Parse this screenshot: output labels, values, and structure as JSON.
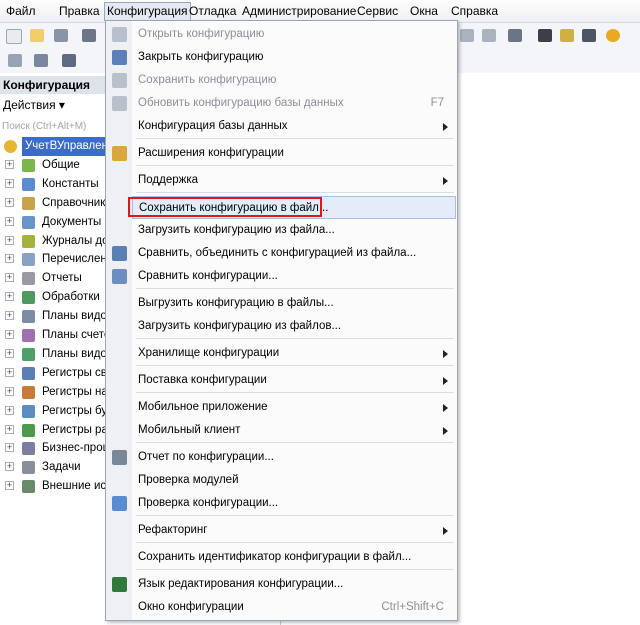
{
  "menubar": [
    "Файл",
    "Правка",
    "Конфигурация",
    "Отладка",
    "Администрирование",
    "Сервис",
    "Окна",
    "Справка"
  ],
  "left_panel": {
    "title": "Конфигурация",
    "actions": "Действия",
    "search_placeholder": "Поиск (Ctrl+Alt+M)",
    "root": "УчетВУправлен",
    "items": [
      "Общие",
      "Константы",
      "Справочники",
      "Документы",
      "Журналы док",
      "Перечисления",
      "Отчеты",
      "Обработки",
      "Планы видов",
      "Планы счетов",
      "Планы видов",
      "Регистры св",
      "Регистры на",
      "Регистры бу",
      "Регистры ра",
      "Бизнес-проц",
      "Задачи",
      "Внешние ис"
    ]
  },
  "menu": {
    "items": [
      {
        "label": "Открыть конфигурацию",
        "disabled": true
      },
      {
        "label": "Закрыть конфигурацию"
      },
      {
        "label": "Сохранить конфигурацию",
        "disabled": true
      },
      {
        "label": "Обновить конфигурацию базы данных",
        "disabled": true,
        "shortcut": "F7"
      },
      {
        "label": "Конфигурация базы данных",
        "submenu": true
      },
      {
        "label": "Расширения конфигурации"
      },
      {
        "label": "Поддержка",
        "submenu": true
      },
      {
        "label": "Сохранить конфигурацию в файл...",
        "highlighted": true
      },
      {
        "label": "Загрузить конфигурацию из файла..."
      },
      {
        "label": "Сравнить, объединить с конфигурацией из файла..."
      },
      {
        "label": "Сравнить конфигурации..."
      },
      {
        "label": "Выгрузить конфигурацию в файлы..."
      },
      {
        "label": "Загрузить конфигурацию из файлов..."
      },
      {
        "label": "Хранилище конфигурации",
        "submenu": true
      },
      {
        "label": "Поставка конфигурации",
        "submenu": true
      },
      {
        "label": "Мобильное приложение",
        "submenu": true
      },
      {
        "label": "Мобильный клиент",
        "submenu": true
      },
      {
        "label": "Отчет по конфигурации..."
      },
      {
        "label": "Проверка модулей"
      },
      {
        "label": "Проверка конфигурации..."
      },
      {
        "label": "Рефакторинг",
        "submenu": true
      },
      {
        "label": "Сохранить идентификатор конфигурации в файл..."
      },
      {
        "label": "Язык редактирования конфигурации..."
      },
      {
        "label": "Окно конфигурации",
        "shortcut": "Ctrl+Shift+C"
      }
    ]
  },
  "colors": {
    "highlight_border": "#e2141c",
    "selection": "#3b6cc9"
  }
}
